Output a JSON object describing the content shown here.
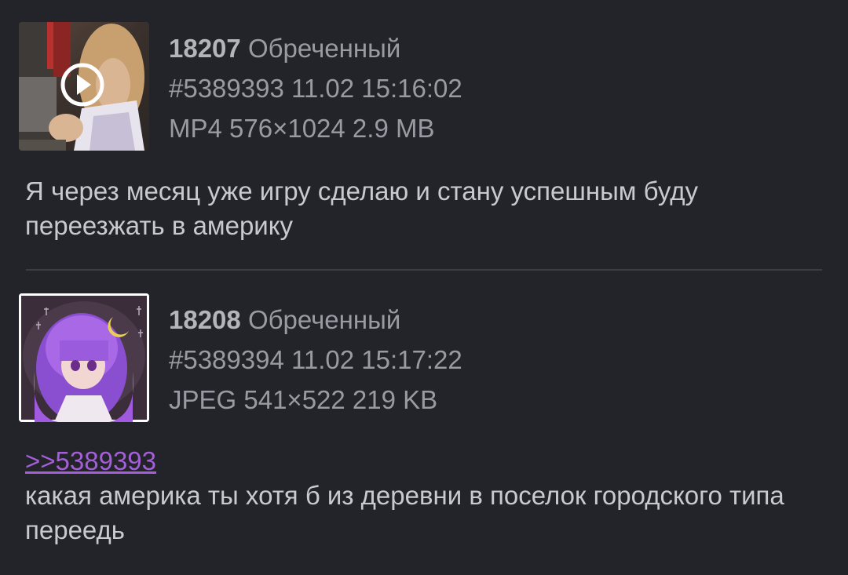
{
  "posts": [
    {
      "number": "18207",
      "name": "Обреченный",
      "id_date": "#5389393 11.02 15:16:02",
      "file_info": "MP4 576×1024 2.9 MB",
      "thumb_type": "video",
      "reply_link": "",
      "text": "Я через месяц уже игру сделаю и стану успешным буду переезжать в америку"
    },
    {
      "number": "18208",
      "name": "Обреченный",
      "id_date": "#5389394 11.02 15:17:22",
      "file_info": "JPEG 541×522 219 KB",
      "thumb_type": "image",
      "reply_link": ">>5389393",
      "text": "какая америка ты хотя б из деревни в поселок городского типа переедь"
    }
  ],
  "colors": {
    "background": "#23232a",
    "text": "#c9c9cf",
    "meta": "#9a9aa2",
    "reply_link": "#a45fd8",
    "divider": "#3c3c45"
  },
  "icons": {
    "play": "play-circle-icon"
  }
}
